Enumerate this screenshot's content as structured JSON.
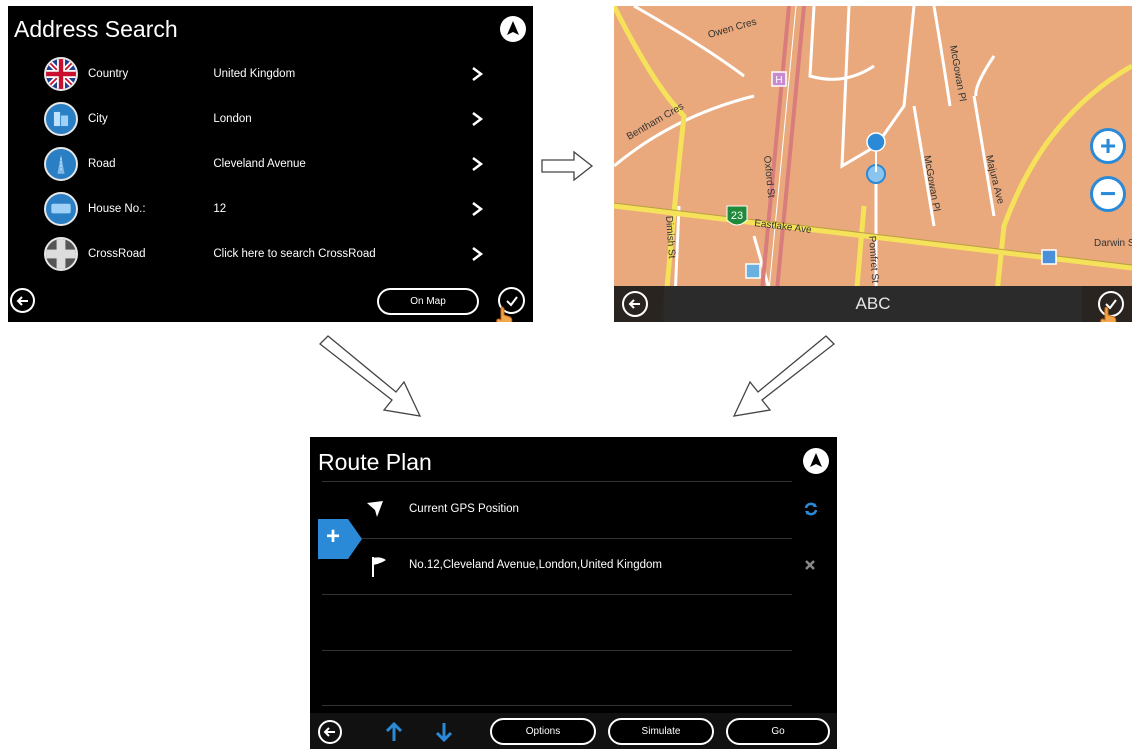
{
  "address_search": {
    "title": "Address Search",
    "rows": [
      {
        "label": "Country",
        "value": "United Kingdom",
        "icon": "uk-flag-icon"
      },
      {
        "label": "City",
        "value": "London",
        "icon": "city-icon"
      },
      {
        "label": "Road",
        "value": "Cleveland Avenue",
        "icon": "road-icon"
      },
      {
        "label": "House No.:",
        "value": "12",
        "icon": "house-number-icon"
      },
      {
        "label": "CrossRoad",
        "value": "Click here to search CrossRoad",
        "icon": "crossroad-icon"
      }
    ],
    "on_map_label": "On Map"
  },
  "map_view": {
    "street_label": "ABC",
    "zoom_in": "+",
    "zoom_out": "−",
    "street_names": [
      "Owen Cres",
      "Bentham Cres",
      "McGowan Pl",
      "McGowan Pl",
      "Majura Ave",
      "Oxford St",
      "Dimish St",
      "Eastlake Ave",
      "Pomfret St",
      "Darwin St"
    ],
    "road_shield": "23",
    "poi_hospital": "H"
  },
  "route_plan": {
    "title": "Route Plan",
    "items": [
      {
        "text": "Current GPS Position",
        "icon": "cursor-arrow-icon",
        "action_icon": "refresh-icon"
      },
      {
        "text": "No.12,Cleveland Avenue,London,United Kingdom",
        "icon": "flag-icon",
        "action_icon": "close-icon"
      }
    ],
    "add_label": "+",
    "buttons": {
      "options": "Options",
      "simulate": "Simulate",
      "go": "Go"
    }
  },
  "colors": {
    "screen_bg": "#000000",
    "map_land": "#e9a97d",
    "map_major_road": "#f5e15a",
    "map_minor_road": "#ffffff",
    "accent_blue": "#2b8ad8",
    "highway_red": "#e07a7a"
  }
}
